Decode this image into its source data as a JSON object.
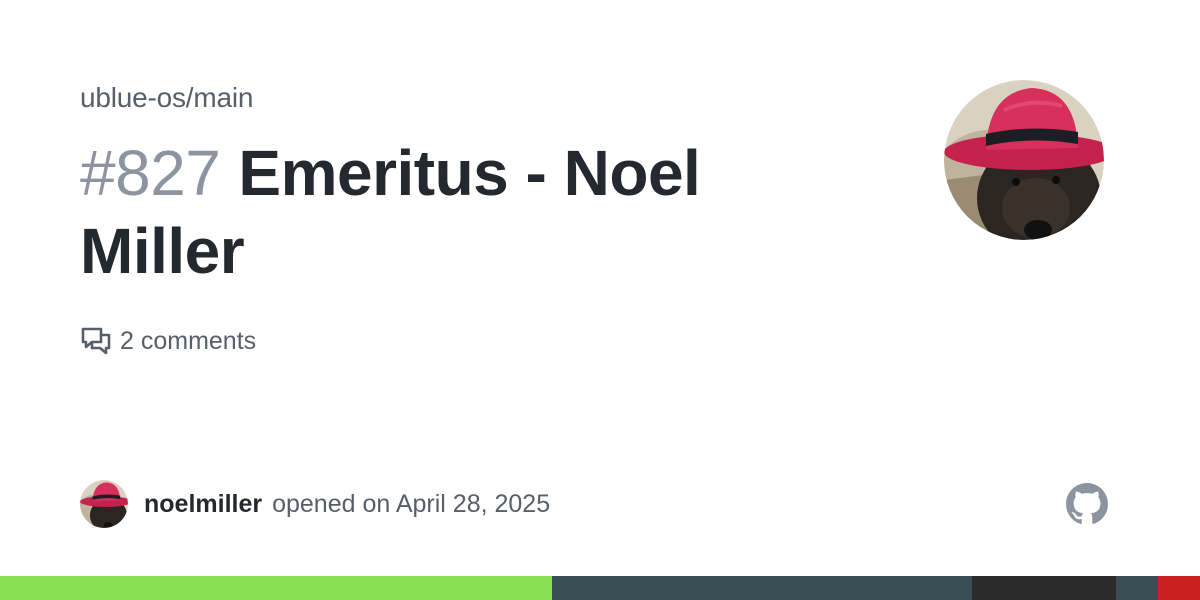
{
  "repo": {
    "name": "ublue-os/main"
  },
  "issue": {
    "number": "#827",
    "title": "Emeritus - Noel Miller"
  },
  "stats": {
    "comments_label": "2 comments",
    "comments_icon": "comment-discussion-icon"
  },
  "author": {
    "username": "noelmiller",
    "opened_text": "opened on April 28, 2025",
    "avatar": "avatar-dog-in-red-hat"
  },
  "brand": {
    "logo": "github-icon"
  },
  "language_bar": {
    "segments": [
      {
        "color": "#89e051",
        "fraction": 0.46
      },
      {
        "color": "#384d54",
        "fraction": 0.35
      },
      {
        "color": "#2b2b2b",
        "fraction": 0.12
      },
      {
        "color": "#384d54",
        "fraction": 0.035
      },
      {
        "color": "#cc1f1f",
        "fraction": 0.035
      }
    ]
  },
  "colors": {
    "text_primary": "#24292f",
    "text_secondary": "#57606a",
    "issue_number": "#8c959f"
  }
}
